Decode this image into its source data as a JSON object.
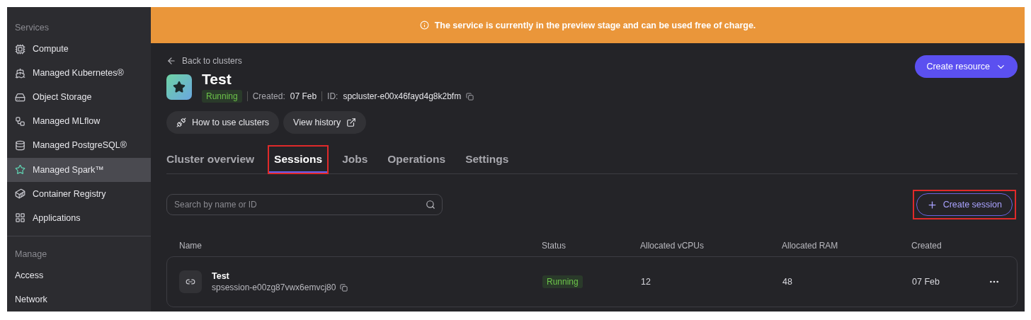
{
  "sidebar": {
    "sections": [
      {
        "title": "Services",
        "items": [
          {
            "label": "Compute",
            "selected": false
          },
          {
            "label": "Managed Kubernetes®",
            "selected": false
          },
          {
            "label": "Object Storage",
            "selected": false
          },
          {
            "label": "Managed MLflow",
            "selected": false
          },
          {
            "label": "Managed PostgreSQL®",
            "selected": false
          },
          {
            "label": "Managed Spark™",
            "selected": true
          },
          {
            "label": "Container Registry",
            "selected": false
          },
          {
            "label": "Applications",
            "selected": false
          }
        ]
      },
      {
        "title": "Manage",
        "items": [
          {
            "label": "Access",
            "selected": false
          },
          {
            "label": "Network",
            "selected": false
          }
        ]
      }
    ]
  },
  "banner": {
    "text": "The service is currently in the preview stage and can be used free of charge."
  },
  "back_link": "Back to clusters",
  "create_resource": "Create resource",
  "cluster": {
    "name": "Test",
    "status": "Running",
    "created_label": "Created:",
    "created": "07 Feb",
    "id_label": "ID:",
    "id": "spcluster-e00x46fayd4g8k2bfm"
  },
  "actions": [
    {
      "label": "How to use clusters",
      "kind": "guide"
    },
    {
      "label": "View history",
      "kind": "external"
    }
  ],
  "tabs": [
    {
      "label": "Cluster overview",
      "selected": false,
      "highlighted": false
    },
    {
      "label": "Sessions",
      "selected": true,
      "highlighted": true
    },
    {
      "label": "Jobs",
      "selected": false,
      "highlighted": false
    },
    {
      "label": "Operations",
      "selected": false,
      "highlighted": false
    },
    {
      "label": "Settings",
      "selected": false,
      "highlighted": false
    }
  ],
  "search": {
    "placeholder": "Search by name or ID"
  },
  "create_session": {
    "label": "Create session",
    "highlighted": true
  },
  "table": {
    "columns": [
      "Name",
      "Status",
      "Allocated vCPUs",
      "Allocated RAM",
      "Created"
    ],
    "rows": [
      {
        "name": "Test",
        "id": "spsession-e00zg87vwx6emvcj80",
        "status": "Running",
        "vcpus": "12",
        "ram": "48",
        "created": "07 Feb"
      }
    ]
  }
}
